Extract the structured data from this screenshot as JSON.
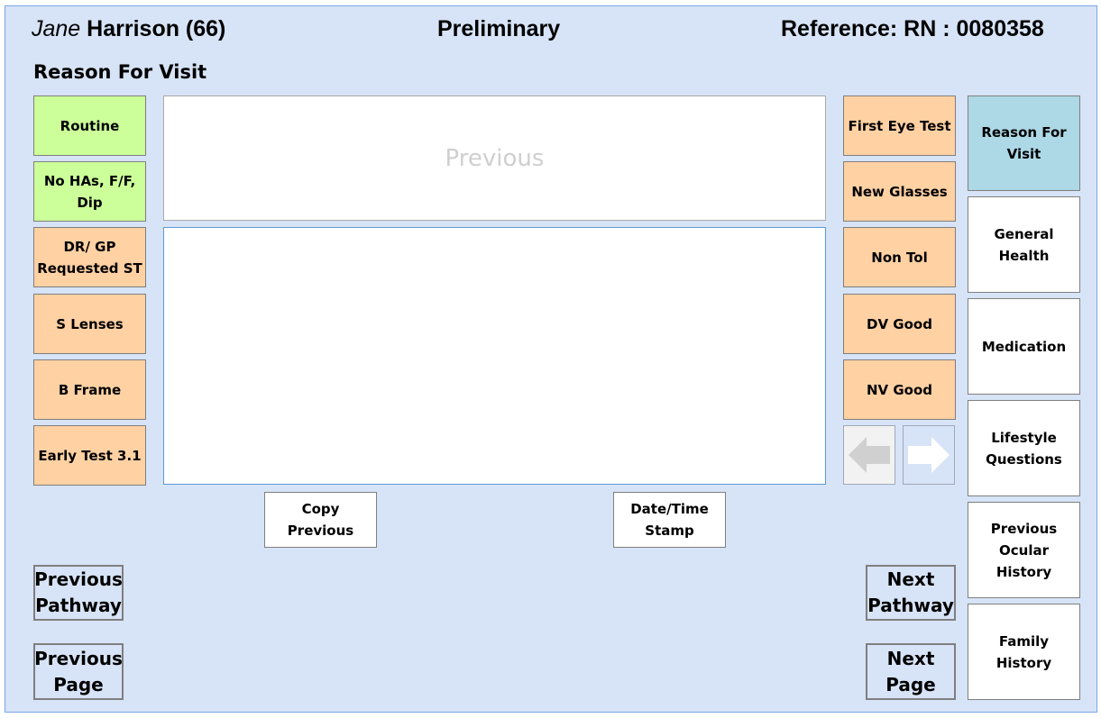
{
  "header": {
    "first_name": "Jane",
    "last_name_age": "Harrison (66)",
    "status": "Preliminary",
    "reference": "Reference: RN : 0080358"
  },
  "section_title": "Reason For Visit",
  "left_buttons": [
    {
      "label": "Routine",
      "color": "#ccff99"
    },
    {
      "label": "No HAs, F/F, Dip",
      "color": "#ccff99"
    },
    {
      "label": "DR/ GP Requested  ST",
      "color": "#ffd1a3"
    },
    {
      "label": "S Lenses",
      "color": "#ffd1a3"
    },
    {
      "label": "B Frame",
      "color": "#ffd1a3"
    },
    {
      "label": "Early Test 3.1",
      "color": "#ffd1a3"
    }
  ],
  "right_buttons": [
    {
      "label": "First Eye Test"
    },
    {
      "label": "New Glasses"
    },
    {
      "label": "Non Tol"
    },
    {
      "label": "DV Good"
    },
    {
      "label": "NV Good"
    }
  ],
  "previous_box": {
    "placeholder": "Previous"
  },
  "notes": {
    "value": ""
  },
  "actions": {
    "copy_previous": "Copy Previous",
    "date_time_stamp": "Date/Time Stamp"
  },
  "navigation": {
    "previous_pathway": "Previous Pathway",
    "previous_page": "Previous Page",
    "next_pathway": "Next Pathway",
    "next_page": "Next Page",
    "arrow_left": "arrow-left-icon",
    "arrow_right": "arrow-right-icon"
  },
  "side_tabs": [
    {
      "label": "Reason For Visit",
      "selected": true
    },
    {
      "label": "General Health",
      "selected": false
    },
    {
      "label": "Medication",
      "selected": false
    },
    {
      "label": "Lifestyle Questions",
      "selected": false
    },
    {
      "label": "Previous Ocular History",
      "selected": false
    },
    {
      "label": "Family History",
      "selected": false
    }
  ],
  "colors": {
    "background": "#d7e3f6",
    "green_button": "#ccff99",
    "orange_button": "#ffd1a3",
    "selected_tab": "#add8e6"
  }
}
